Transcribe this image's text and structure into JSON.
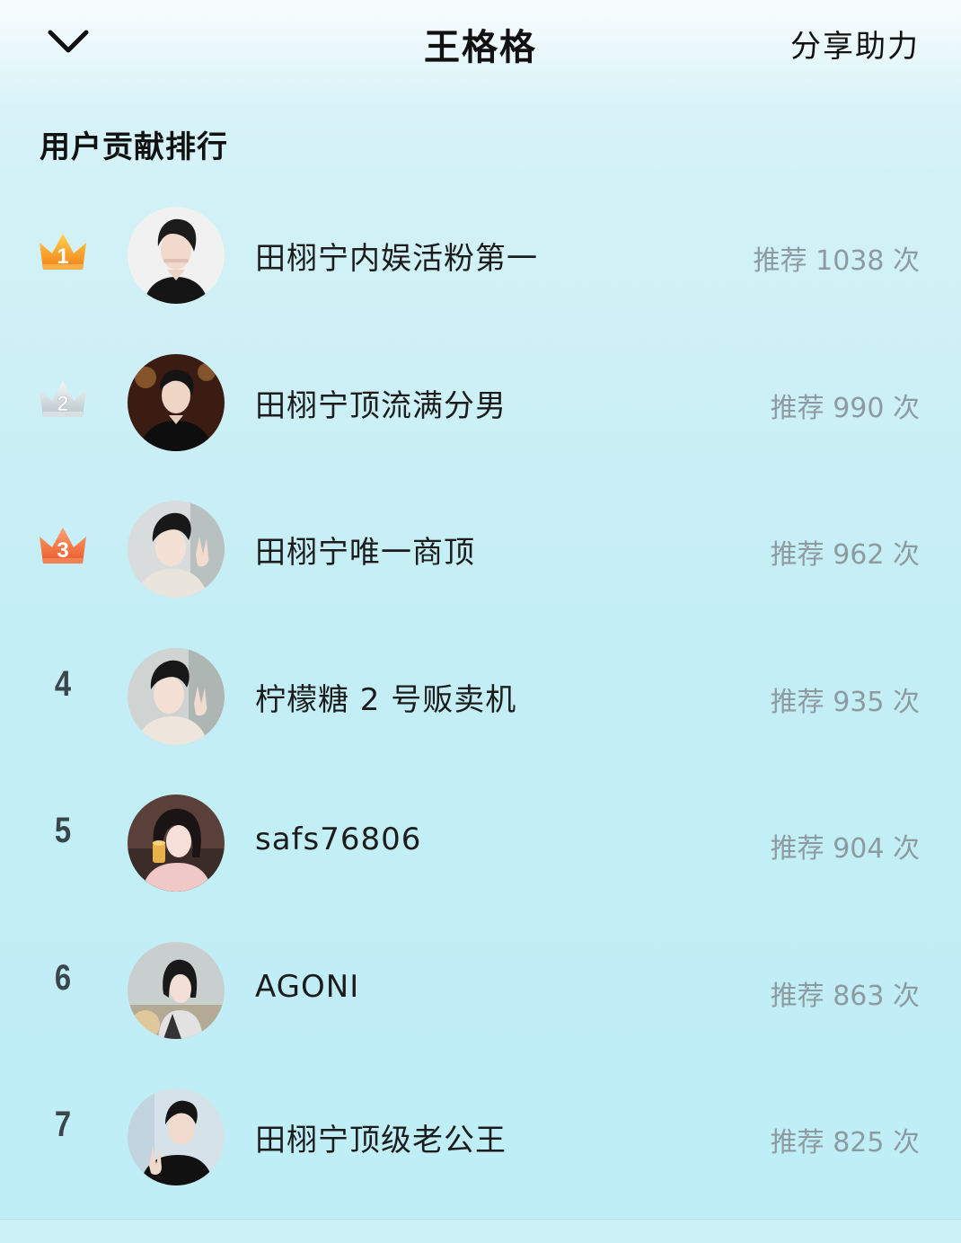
{
  "header": {
    "back_icon": "chevron-down-icon",
    "title": "王格格",
    "share_label": "分享助力"
  },
  "section": {
    "title": "用户贡献排行"
  },
  "colors": {
    "gold_crown": "#f8a326",
    "silver_crown": "#c8d2d6",
    "bronze_crown": "#f06a3c"
  },
  "ranking": [
    {
      "rank": "1",
      "badge": "crown-gold-icon",
      "name": "田栩宁内娱活粉第一",
      "count": "推荐 1038 次"
    },
    {
      "rank": "2",
      "badge": "crown-silver-icon",
      "name": "田栩宁顶流满分男",
      "count": "推荐 990 次"
    },
    {
      "rank": "3",
      "badge": "crown-bronze-icon",
      "name": "田栩宁唯一商顶",
      "count": "推荐 962 次"
    },
    {
      "rank": "4",
      "badge": "",
      "name": "柠檬糖 2 号贩卖机",
      "count": "推荐 935 次"
    },
    {
      "rank": "5",
      "badge": "",
      "name": "safs76806",
      "count": "推荐 904 次"
    },
    {
      "rank": "6",
      "badge": "",
      "name": "AGONI",
      "count": "推荐 863 次"
    },
    {
      "rank": "7",
      "badge": "",
      "name": "田栩宁顶级老公王",
      "count": "推荐 825 次"
    }
  ]
}
